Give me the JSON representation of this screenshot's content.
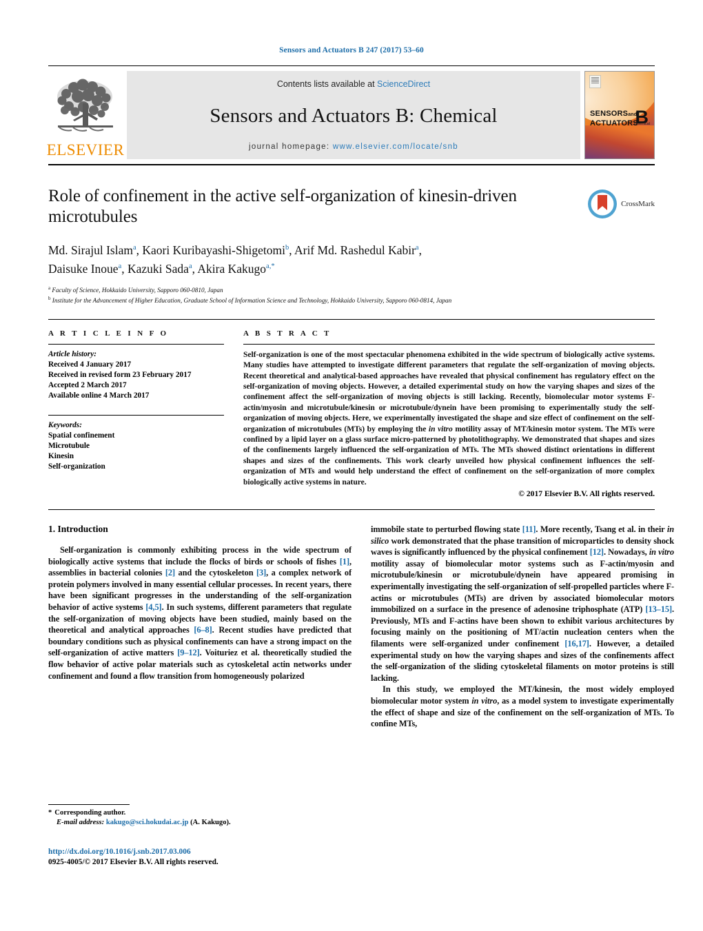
{
  "running_head": "Sensors and Actuators B 247 (2017) 53–60",
  "masthead": {
    "contents_prefix": "Contents lists available at ",
    "sciencedirect": "ScienceDirect",
    "journal_title": "Sensors and Actuators B: Chemical",
    "homepage_prefix": "journal homepage: ",
    "homepage_url": "www.elsevier.com/locate/snb",
    "elsevier_wordmark": "ELSEVIER",
    "cover": {
      "line1": "SENSORS",
      "line1_small": "and",
      "line2": "ACTUATORS",
      "letter": "B",
      "sub": "Chemical"
    },
    "accent_color": "#2b7bb9",
    "elsevier_orange": "#ED8B00"
  },
  "article": {
    "title": "Role of confinement in the active self-organization of kinesin-driven microtubules",
    "crossmark_label": "CrossMark",
    "authors_line1": "Md. Sirajul Islam<sup>a</sup>, Kaori Kuribayashi-Shigetomi<sup>b</sup>, Arif Md. Rashedul Kabir<sup>a</sup>,",
    "authors_line2": "Daisuke Inoue<sup>a</sup>, Kazuki Sada<sup>a</sup>, Akira Kakugo<sup>a,*</sup>",
    "affiliation_a": "<sup>a</sup> Faculty of Science, Hokkaido University, Sapporo 060-0810, Japan",
    "affiliation_b": "<sup>b</sup> Institute for the Advancement of Higher Education, Graduate School of Information Science and Technology, Hokkaido University, Sapporo 060-0814, Japan"
  },
  "article_info": {
    "heading": "A R T I C L E   I N F O",
    "history_title": "Article history:",
    "history": [
      "Received 4 January 2017",
      "Received in revised form 23 February 2017",
      "Accepted 2 March 2017",
      "Available online 4 March 2017"
    ],
    "keywords_title": "Keywords:",
    "keywords": [
      "Spatial confinement",
      "Microtubule",
      "Kinesin",
      "Self-organization"
    ]
  },
  "abstract": {
    "heading": "A B S T R A C T",
    "body_part1": "Self-organization is one of the most spectacular phenomena exhibited in the wide spectrum of biologically active systems. Many studies have attempted to investigate different parameters that regulate the self-organization of moving objects. Recent theoretical and analytical-based approaches have revealed that physical confinement has regulatory effect on the self-organization of moving objects. However, a detailed experimental study on how the varying shapes and sizes of the confinement affect the self-organization of moving objects is still lacking. Recently, biomolecular motor systems F-actin/myosin and microtubule/kinesin or microtubule/dynein have been promising to experimentally study the self-organization of moving objects. Here, we experimentally investigated the shape and size effect of confinement on the self-organization of microtubules (MTs) by employing the ",
    "italic1": "in vitro",
    "body_part2": " motility assay of MT/kinesin motor system. The MTs were confined by a lipid layer on a glass surface micro-patterned by photolithography. We demonstrated that shapes and sizes of the confinements largely influenced the self-organization of MTs. The MTs showed distinct orientations in different shapes and sizes of the confinements. This work clearly unveiled how physical confinement influences the self-organization of MTs and would help understand the effect of confinement on the self-organization of more complex biologically active systems in nature.",
    "copyright": "© 2017 Elsevier B.V. All rights reserved."
  },
  "body": {
    "section_number_title": "1.  Introduction",
    "left_paragraph_1": "Self-organization is commonly exhibiting process in the wide spectrum of biologically active systems that include the flocks of birds or schools of fishes [1], assemblies in bacterial colonies [2] and the cytoskeleton [3], a complex network of protein polymers involved in many essential cellular processes. In recent years, there have been significant progresses in the understanding of the self-organization behavior of active systems [4,5]. In such systems, different parameters that regulate the self-organization of moving objects have been studied, mainly based on the theoretical and analytical approaches [6–8]. Recent studies have predicted that boundary conditions such as physical confinements can have a strong impact on the self-organization of active matters [9–12]. Voituriez et al. theoretically studied the flow behavior of active polar materials such as cytoskeletal actin networks under confinement and found a flow transition from homogeneously polarized",
    "right_paragraph_1": "immobile state to perturbed flowing state [11]. More recently, Tsang et al. in their in silico work demonstrated that the phase transition of microparticles to density shock waves is significantly influenced by the physical confinement [12]. Nowadays, in vitro motility assay of biomolecular motor systems such as F-actin/myosin and microtubule/kinesin or microtubule/dynein have appeared promising in experimentally investigating the self-organization of self-propelled particles where F-actins or microtubules (MTs) are driven by associated biomolecular motors immobilized on a surface in the presence of adenosine triphosphate (ATP) [13–15]. Previously, MTs and F-actins have been shown to exhibit various architectures by focusing mainly on the positioning of MT/actin nucleation centers when the filaments were self-organized under confinement [16,17]. However, a detailed experimental study on how the varying shapes and sizes of the confinements affect the self-organization of the sliding cytoskeletal filaments on motor proteins is still lacking.",
    "right_paragraph_2": "In this study, we employed the MT/kinesin, the most widely employed biomolecular motor system in vitro, as a model system to investigate experimentally the effect of shape and size of the confinement on the self-organization of MTs. To confine MTs,"
  },
  "footer": {
    "corresponding_marker": "*",
    "corresponding_label": "Corresponding author.",
    "email_label": "E-mail address:",
    "email": "kakugo@sci.hokudai.ac.jp",
    "email_suffix": "(A. Kakugo).",
    "doi": "http://dx.doi.org/10.1016/j.snb.2017.03.006",
    "issn_line": "0925-4005/© 2017 Elsevier B.V. All rights reserved."
  }
}
